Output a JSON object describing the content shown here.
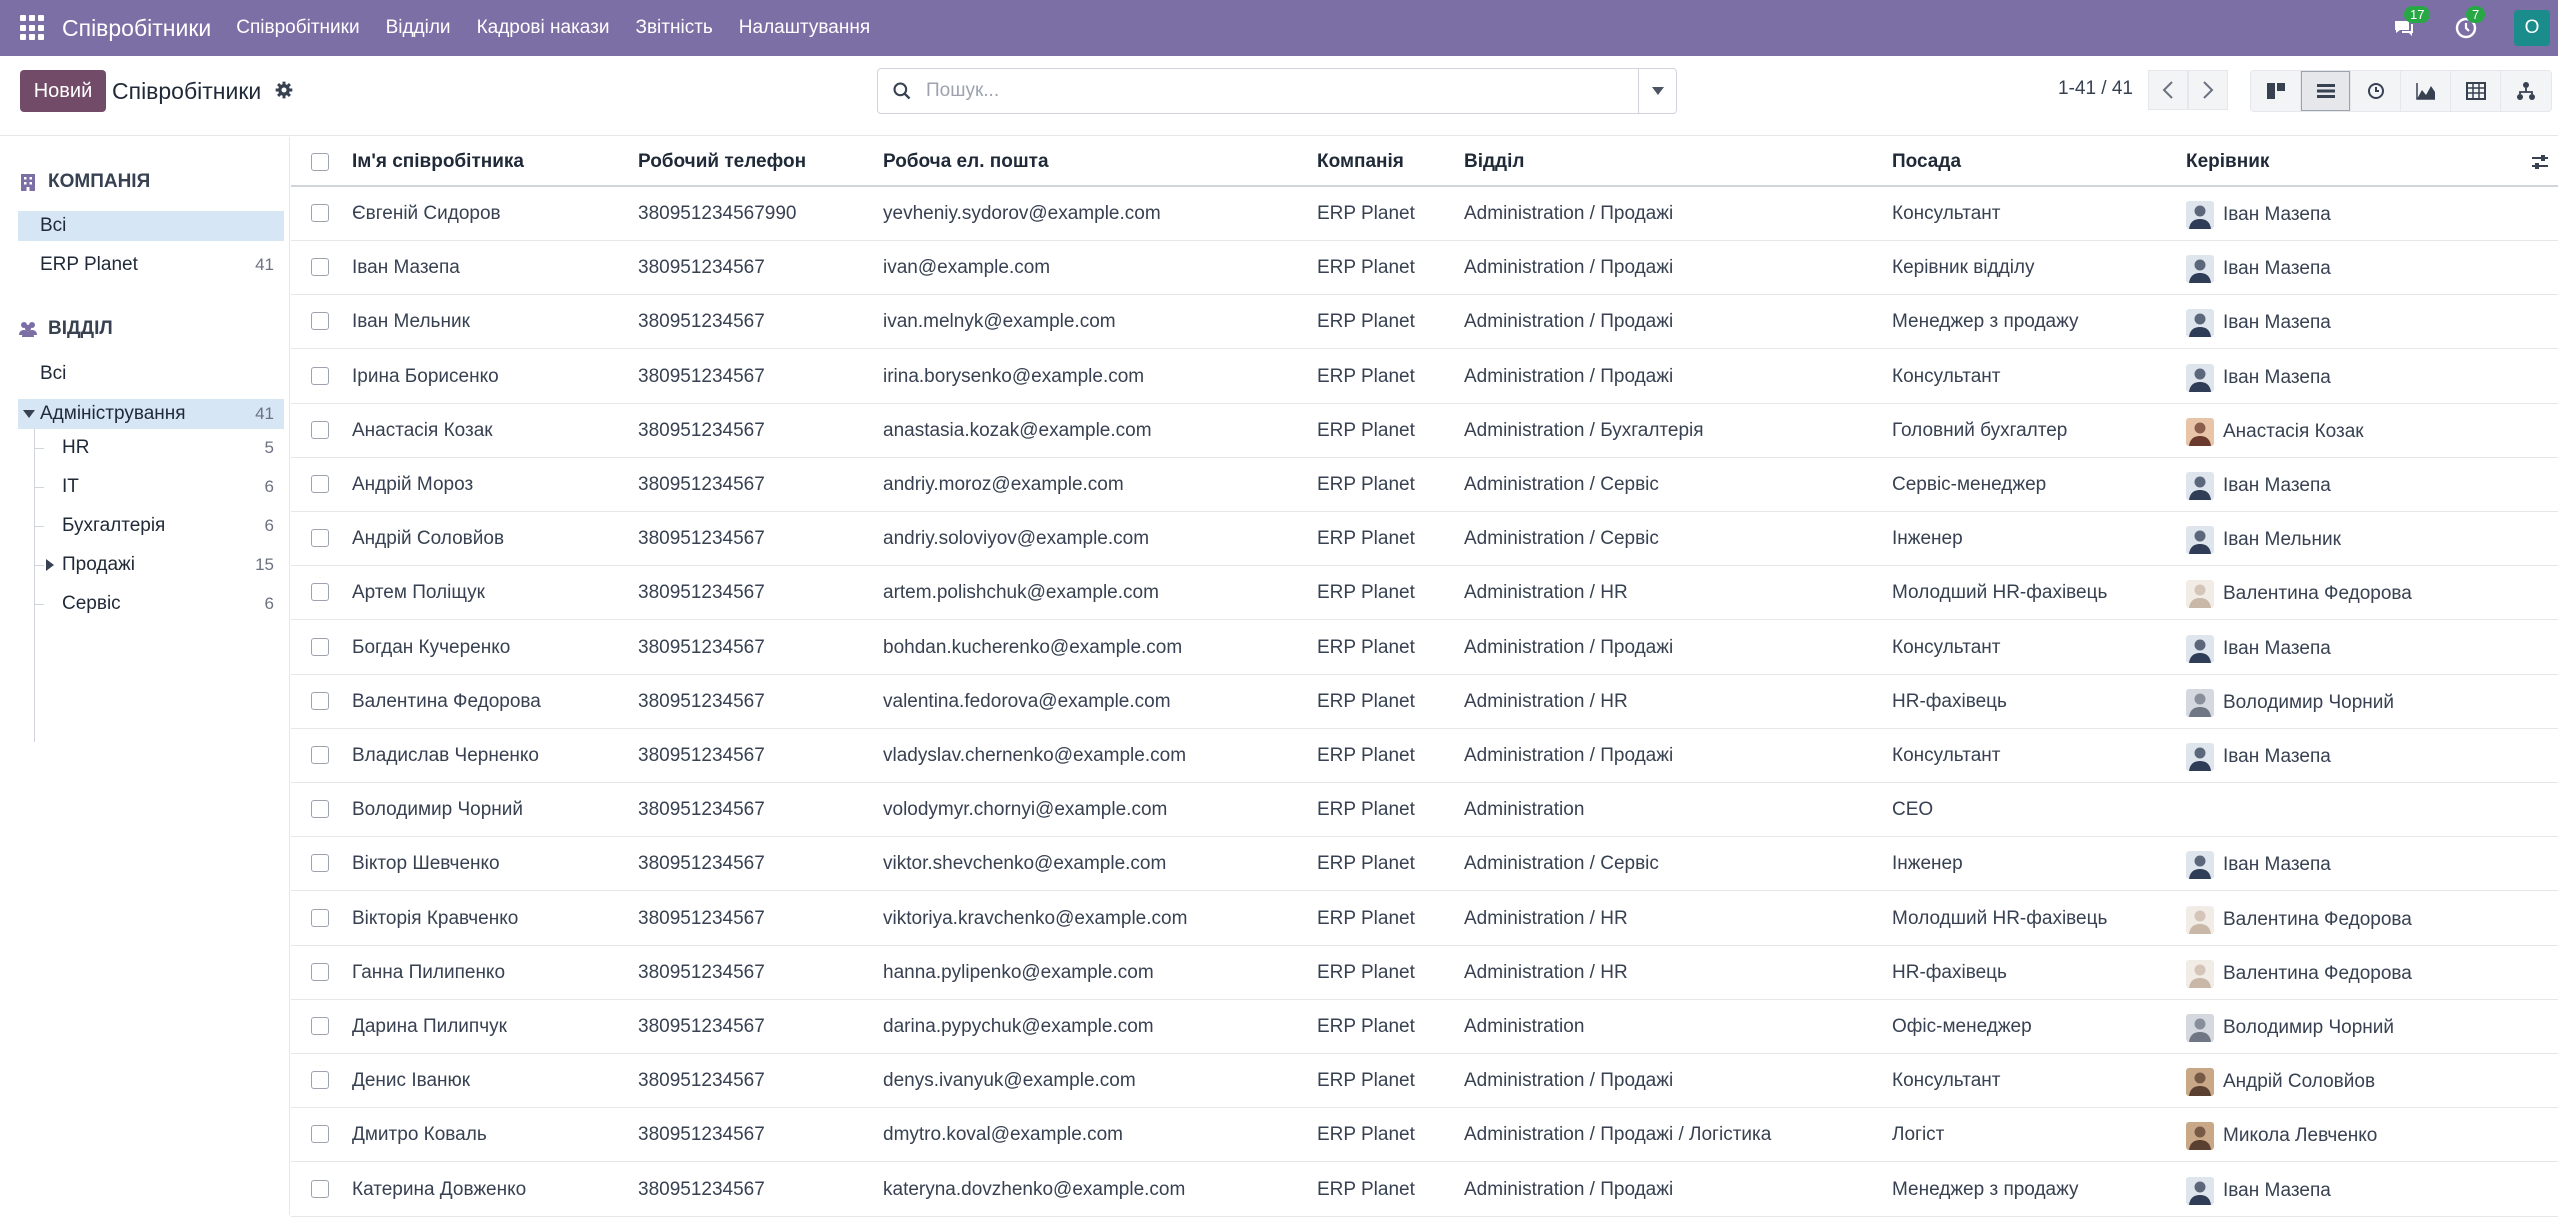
{
  "navbar": {
    "brand": "Співробітники",
    "menu": [
      "Співробітники",
      "Відділи",
      "Кадрові накази",
      "Звітність",
      "Налаштування"
    ],
    "messages_count": "17",
    "activities_count": "7",
    "user_initial": "O"
  },
  "control": {
    "new_label": "Новий",
    "title": "Співробітники",
    "search_placeholder": "Пошук...",
    "pager": "1-41 / 41"
  },
  "sidebar": {
    "company_heading": "КОМПАНІЯ",
    "company_items": [
      {
        "label": "Всі",
        "count": ""
      },
      {
        "label": "ERP Planet",
        "count": "41"
      }
    ],
    "department_heading": "ВІДДІЛ",
    "department_all": "Всі",
    "department_root": {
      "label": "Адміністрування",
      "count": "41"
    },
    "department_children": [
      {
        "label": "HR",
        "count": "5"
      },
      {
        "label": "IT",
        "count": "6"
      },
      {
        "label": "Бухгалтерія",
        "count": "6"
      },
      {
        "label": "Продажі",
        "count": "15"
      },
      {
        "label": "Сервіс",
        "count": "6"
      }
    ]
  },
  "table": {
    "columns": [
      "Ім'я співробітника",
      "Робочий телефон",
      "Робоча ел. пошта",
      "Компанія",
      "Відділ",
      "Посада",
      "Керівник"
    ],
    "rows": [
      {
        "name": "Євгеній Сидоров",
        "phone": "380951234567990",
        "email": "yevheniy.sydorov@example.com",
        "company": "ERP Planet",
        "dept": "Administration / Продажі",
        "job": "Консультант",
        "manager": "Іван Мазепа",
        "avatar": "dark"
      },
      {
        "name": "Іван Мазепа",
        "phone": "380951234567",
        "email": "ivan@example.com",
        "company": "ERP Planet",
        "dept": "Administration / Продажі",
        "job": "Керівник відділу",
        "manager": "Іван Мазепа",
        "avatar": "dark"
      },
      {
        "name": "Іван Мельник",
        "phone": "380951234567",
        "email": "ivan.melnyk@example.com",
        "company": "ERP Planet",
        "dept": "Administration / Продажі",
        "job": "Менеджер з продажу",
        "manager": "Іван Мазепа",
        "avatar": "dark"
      },
      {
        "name": "Ірина Борисенко",
        "phone": "380951234567",
        "email": "irina.borysenko@example.com",
        "company": "ERP Planet",
        "dept": "Administration / Продажі",
        "job": "Консультант",
        "manager": "Іван Мазепа",
        "avatar": "dark"
      },
      {
        "name": "Анастасія Козак",
        "phone": "380951234567",
        "email": "anastasia.kozak@example.com",
        "company": "ERP Planet",
        "dept": "Administration / Бухгалтерія",
        "job": "Головний бухгалтер",
        "manager": "Анастасія Козак",
        "avatar": "woman"
      },
      {
        "name": "Андрій Мороз",
        "phone": "380951234567",
        "email": "andriy.moroz@example.com",
        "company": "ERP Planet",
        "dept": "Administration / Сервіс",
        "job": "Сервіс-менеджер",
        "manager": "Іван Мазепа",
        "avatar": "dark"
      },
      {
        "name": "Андрій Соловйов",
        "phone": "380951234567",
        "email": "andriy.soloviyov@example.com",
        "company": "ERP Planet",
        "dept": "Administration / Сервіс",
        "job": "Інженер",
        "manager": "Іван Мельник",
        "avatar": "dark"
      },
      {
        "name": "Артем Поліщук",
        "phone": "380951234567",
        "email": "artem.polishchuk@example.com",
        "company": "ERP Planet",
        "dept": "Administration / HR",
        "job": "Молодший HR-фахівець",
        "manager": "Валентина Федорова",
        "avatar": "light"
      },
      {
        "name": "Богдан Кучеренко",
        "phone": "380951234567",
        "email": "bohdan.kucherenko@example.com",
        "company": "ERP Planet",
        "dept": "Administration / Продажі",
        "job": "Консультант",
        "manager": "Іван Мазепа",
        "avatar": "dark"
      },
      {
        "name": "Валентина Федорова",
        "phone": "380951234567",
        "email": "valentina.fedorova@example.com",
        "company": "ERP Planet",
        "dept": "Administration / HR",
        "job": "HR-фахівець",
        "manager": "Володимир Чорний",
        "avatar": "grey"
      },
      {
        "name": "Владислав Черненко",
        "phone": "380951234567",
        "email": "vladyslav.chernenko@example.com",
        "company": "ERP Planet",
        "dept": "Administration / Продажі",
        "job": "Консультант",
        "manager": "Іван Мазепа",
        "avatar": "dark"
      },
      {
        "name": "Володимир Чорний",
        "phone": "380951234567",
        "email": "volodymyr.chornyi@example.com",
        "company": "ERP Planet",
        "dept": "Administration",
        "job": "CEO",
        "manager": "",
        "avatar": ""
      },
      {
        "name": "Віктор Шевченко",
        "phone": "380951234567",
        "email": "viktor.shevchenko@example.com",
        "company": "ERP Planet",
        "dept": "Administration / Сервіс",
        "job": "Інженер",
        "manager": "Іван Мазепа",
        "avatar": "dark"
      },
      {
        "name": "Вікторія Кравченко",
        "phone": "380951234567",
        "email": "viktoriya.kravchenko@example.com",
        "company": "ERP Planet",
        "dept": "Administration / HR",
        "job": "Молодший HR-фахівець",
        "manager": "Валентина Федорова",
        "avatar": "light"
      },
      {
        "name": "Ганна Пилипенко",
        "phone": "380951234567",
        "email": "hanna.pylipenko@example.com",
        "company": "ERP Planet",
        "dept": "Administration / HR",
        "job": "HR-фахівець",
        "manager": "Валентина Федорова",
        "avatar": "light"
      },
      {
        "name": "Дарина Пилипчук",
        "phone": "380951234567",
        "email": "darina.pypychuk@example.com",
        "company": "ERP Planet",
        "dept": "Administration",
        "job": "Офіс-менеджер",
        "manager": "Володимир Чорний",
        "avatar": "grey"
      },
      {
        "name": "Денис Іванюк",
        "phone": "380951234567",
        "email": "denys.ivanyuk@example.com",
        "company": "ERP Planet",
        "dept": "Administration / Продажі",
        "job": "Консультант",
        "manager": "Андрій Соловйов",
        "avatar": "brown"
      },
      {
        "name": "Дмитро Коваль",
        "phone": "380951234567",
        "email": "dmytro.koval@example.com",
        "company": "ERP Planet",
        "dept": "Administration / Продажі / Логістика",
        "job": "Логіст",
        "manager": "Микола Левченко",
        "avatar": "brown"
      },
      {
        "name": "Катерина Довженко",
        "phone": "380951234567",
        "email": "kateryna.dovzhenko@example.com",
        "company": "ERP Planet",
        "dept": "Administration / Продажі",
        "job": "Менеджер з продажу",
        "manager": "Іван Мазепа",
        "avatar": "dark"
      }
    ]
  },
  "colors": {
    "navbar": "#7c6fa6",
    "primary_button": "#714b67",
    "sidebar_active": "#d6e6f5",
    "badge": "#28a745",
    "user_avatar": "#1a8c8c"
  }
}
